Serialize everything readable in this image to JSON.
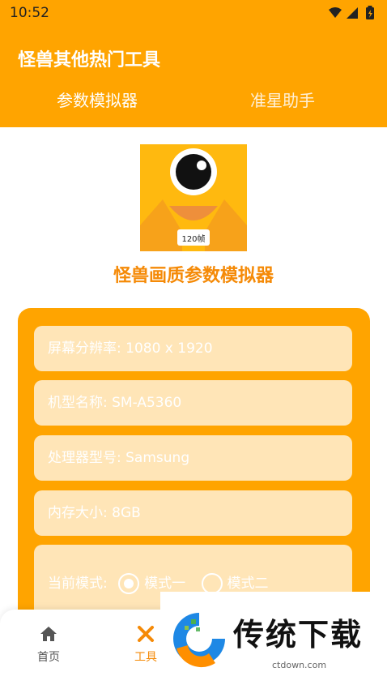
{
  "status": {
    "time": "10:52"
  },
  "appbar": {
    "title": "怪兽其他热门工具"
  },
  "tabs": [
    {
      "label": "参数模拟器"
    },
    {
      "label": "准星助手"
    }
  ],
  "app": {
    "name": "怪兽画质参数模拟器",
    "logo_badge": "120帧"
  },
  "fields": [
    {
      "label": "屏幕分辨率:",
      "value": "1080 x 1920"
    },
    {
      "label": "机型名称:",
      "value": "SM-A5360"
    },
    {
      "label": "处理器型号:",
      "value": "Samsung"
    },
    {
      "label": "内存大小:",
      "value": "8GB"
    }
  ],
  "mode": {
    "label": "当前模式:",
    "options": [
      "模式一",
      "模式二"
    ],
    "selected": "模式一"
  },
  "nav": [
    {
      "label": "首页",
      "icon": "home-icon"
    },
    {
      "label": "工具",
      "icon": "tools-icon"
    }
  ],
  "watermark": {
    "text": "传统下载",
    "url": "ctdown.com"
  },
  "colors": {
    "primary": "#FFA400",
    "accent": "#F58A07",
    "field_bg": "#FFE5B7"
  }
}
